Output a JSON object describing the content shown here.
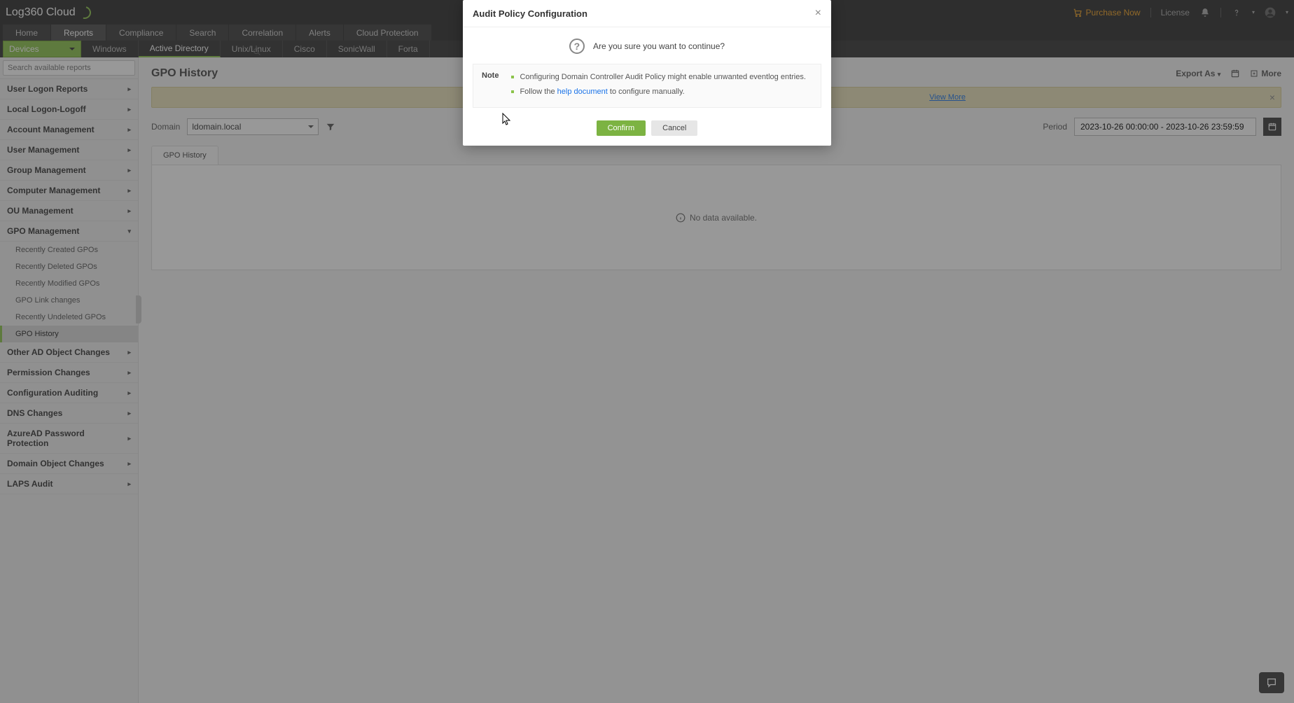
{
  "header": {
    "logo_text": "Log360 Cloud",
    "purchase": "Purchase Now",
    "license": "License"
  },
  "main_tabs": [
    "Home",
    "Reports",
    "Compliance",
    "Search",
    "Correlation",
    "Alerts",
    "Cloud Protection"
  ],
  "main_tab_active": 1,
  "sub_dropdown": "Devices",
  "sub_tabs": [
    "Windows",
    "Active Directory",
    "Unix/Linux",
    "Cisco",
    "SonicWall",
    "Forta"
  ],
  "sub_tab_active": 1,
  "sidebar": {
    "search_placeholder": "Search available reports",
    "categories": [
      {
        "label": "User Logon Reports",
        "expanded": false
      },
      {
        "label": "Local Logon-Logoff",
        "expanded": false
      },
      {
        "label": "Account Management",
        "expanded": false
      },
      {
        "label": "User Management",
        "expanded": false
      },
      {
        "label": "Group Management",
        "expanded": false
      },
      {
        "label": "Computer Management",
        "expanded": false
      },
      {
        "label": "OU Management",
        "expanded": false
      },
      {
        "label": "GPO Management",
        "expanded": true,
        "items": [
          "Recently Created GPOs",
          "Recently Deleted GPOs",
          "Recently Modified GPOs",
          "GPO Link changes",
          "Recently Undeleted GPOs",
          "GPO History"
        ],
        "active_item": 5
      },
      {
        "label": "Other AD Object Changes",
        "expanded": false
      },
      {
        "label": "Permission Changes",
        "expanded": false
      },
      {
        "label": "Configuration Auditing",
        "expanded": false
      },
      {
        "label": "DNS Changes",
        "expanded": false
      },
      {
        "label": "AzureAD Password Protection",
        "expanded": false
      },
      {
        "label": "Domain Object Changes",
        "expanded": false
      },
      {
        "label": "LAPS Audit",
        "expanded": false
      }
    ]
  },
  "page": {
    "title": "GPO History",
    "export_label": "Export As",
    "more_label": "More",
    "banner_link": "View More",
    "domain_label": "Domain",
    "domain_value": "ldomain.local",
    "period_label": "Period",
    "period_value": "2023-10-26 00:00:00 - 2023-10-26 23:59:59",
    "content_tab": "GPO History",
    "nodata": "No data available."
  },
  "modal": {
    "title": "Audit Policy Configuration",
    "question": "Are you sure you want to continue?",
    "note_label": "Note",
    "note1": "Configuring Domain Controller Audit Policy might enable unwanted eventlog entries.",
    "note2_pre": "Follow the ",
    "note2_link": "help document",
    "note2_post": " to configure manually.",
    "confirm": "Confirm",
    "cancel": "Cancel"
  }
}
